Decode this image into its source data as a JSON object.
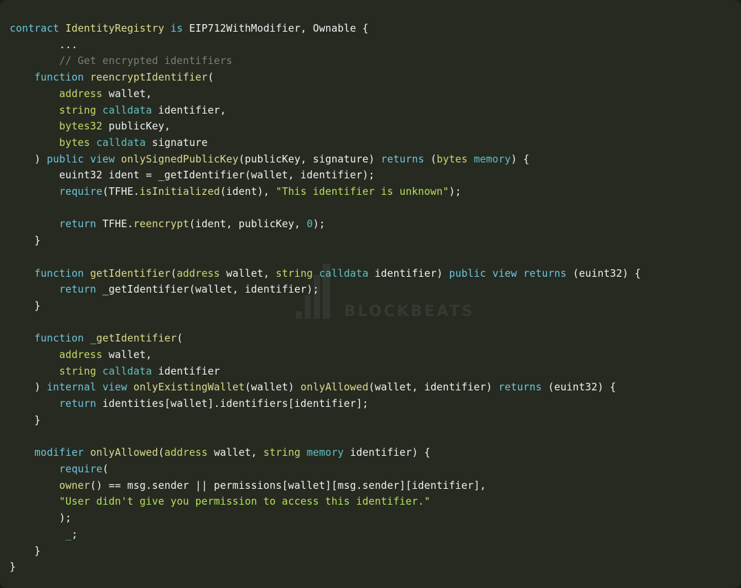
{
  "editor": {
    "language": "solidity",
    "background_color": "#262a21",
    "foreground_color": "#f1f1f1",
    "watermark": {
      "brand": "BLOCKBEATS",
      "logo_name": "bar-chart-logo"
    },
    "palette": {
      "keyword": "#6fc5dd",
      "type": "#c9d96a",
      "data_location": "#5fc2c2",
      "function_name": "#dcdb8e",
      "string": "#b4e05a",
      "number": "#5fc2c2",
      "comment": "#7d7f78",
      "plain": "#f1f1f1"
    }
  },
  "code": {
    "lines": [
      {
        "id": 1,
        "text": "contract IdentityRegistry is EIP712WithModifier, Ownable {"
      },
      {
        "id": 2,
        "text": "        ..."
      },
      {
        "id": 3,
        "text": "        // Get encrypted identifiers"
      },
      {
        "id": 4,
        "text": "    function reencryptIdentifier("
      },
      {
        "id": 5,
        "text": "        address wallet,"
      },
      {
        "id": 6,
        "text": "        string calldata identifier,"
      },
      {
        "id": 7,
        "text": "        bytes32 publicKey,"
      },
      {
        "id": 8,
        "text": "        bytes calldata signature"
      },
      {
        "id": 9,
        "text": "    ) public view onlySignedPublicKey(publicKey, signature) returns (bytes memory) {"
      },
      {
        "id": 10,
        "text": "        euint32 ident = _getIdentifier(wallet, identifier);"
      },
      {
        "id": 11,
        "text": "        require(TFHE.isInitialized(ident), \"This identifier is unknown\");"
      },
      {
        "id": 12,
        "text": ""
      },
      {
        "id": 13,
        "text": "        return TFHE.reencrypt(ident, publicKey, 0);"
      },
      {
        "id": 14,
        "text": "    }"
      },
      {
        "id": 15,
        "text": ""
      },
      {
        "id": 16,
        "text": "    function getIdentifier(address wallet, string calldata identifier) public view returns (euint32) {"
      },
      {
        "id": 17,
        "text": "        return _getIdentifier(wallet, identifier);"
      },
      {
        "id": 18,
        "text": "    }"
      },
      {
        "id": 19,
        "text": ""
      },
      {
        "id": 20,
        "text": "    function _getIdentifier("
      },
      {
        "id": 21,
        "text": "        address wallet,"
      },
      {
        "id": 22,
        "text": "        string calldata identifier"
      },
      {
        "id": 23,
        "text": "    ) internal view onlyExistingWallet(wallet) onlyAllowed(wallet, identifier) returns (euint32) {"
      },
      {
        "id": 24,
        "text": "        return identities[wallet].identifiers[identifier];"
      },
      {
        "id": 25,
        "text": "    }"
      },
      {
        "id": 26,
        "text": ""
      },
      {
        "id": 27,
        "text": "    modifier onlyAllowed(address wallet, string memory identifier) {"
      },
      {
        "id": 28,
        "text": "        require("
      },
      {
        "id": 29,
        "text": "        owner() == msg.sender || permissions[wallet][msg.sender][identifier],"
      },
      {
        "id": 30,
        "text": "        \"User didn't give you permission to access this identifier.\""
      },
      {
        "id": 31,
        "text": "        );"
      },
      {
        "id": 32,
        "text": "         _;"
      },
      {
        "id": 33,
        "text": "    }"
      },
      {
        "id": 34,
        "text": "}"
      }
    ]
  }
}
